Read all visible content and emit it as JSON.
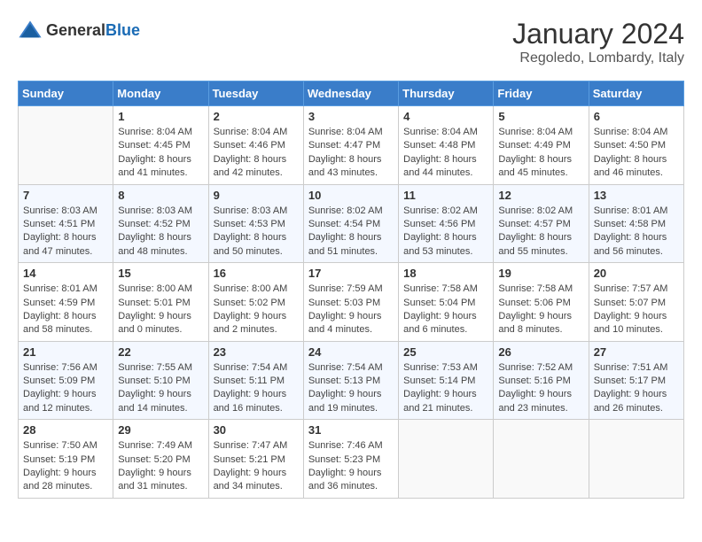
{
  "header": {
    "logo_general": "General",
    "logo_blue": "Blue",
    "month_title": "January 2024",
    "location": "Regoledo, Lombardy, Italy"
  },
  "weekdays": [
    "Sunday",
    "Monday",
    "Tuesday",
    "Wednesday",
    "Thursday",
    "Friday",
    "Saturday"
  ],
  "weeks": [
    [
      {
        "day": "",
        "sunrise": "",
        "sunset": "",
        "daylight": ""
      },
      {
        "day": "1",
        "sunrise": "Sunrise: 8:04 AM",
        "sunset": "Sunset: 4:45 PM",
        "daylight": "Daylight: 8 hours and 41 minutes."
      },
      {
        "day": "2",
        "sunrise": "Sunrise: 8:04 AM",
        "sunset": "Sunset: 4:46 PM",
        "daylight": "Daylight: 8 hours and 42 minutes."
      },
      {
        "day": "3",
        "sunrise": "Sunrise: 8:04 AM",
        "sunset": "Sunset: 4:47 PM",
        "daylight": "Daylight: 8 hours and 43 minutes."
      },
      {
        "day": "4",
        "sunrise": "Sunrise: 8:04 AM",
        "sunset": "Sunset: 4:48 PM",
        "daylight": "Daylight: 8 hours and 44 minutes."
      },
      {
        "day": "5",
        "sunrise": "Sunrise: 8:04 AM",
        "sunset": "Sunset: 4:49 PM",
        "daylight": "Daylight: 8 hours and 45 minutes."
      },
      {
        "day": "6",
        "sunrise": "Sunrise: 8:04 AM",
        "sunset": "Sunset: 4:50 PM",
        "daylight": "Daylight: 8 hours and 46 minutes."
      }
    ],
    [
      {
        "day": "7",
        "sunrise": "Sunrise: 8:03 AM",
        "sunset": "Sunset: 4:51 PM",
        "daylight": "Daylight: 8 hours and 47 minutes."
      },
      {
        "day": "8",
        "sunrise": "Sunrise: 8:03 AM",
        "sunset": "Sunset: 4:52 PM",
        "daylight": "Daylight: 8 hours and 48 minutes."
      },
      {
        "day": "9",
        "sunrise": "Sunrise: 8:03 AM",
        "sunset": "Sunset: 4:53 PM",
        "daylight": "Daylight: 8 hours and 50 minutes."
      },
      {
        "day": "10",
        "sunrise": "Sunrise: 8:02 AM",
        "sunset": "Sunset: 4:54 PM",
        "daylight": "Daylight: 8 hours and 51 minutes."
      },
      {
        "day": "11",
        "sunrise": "Sunrise: 8:02 AM",
        "sunset": "Sunset: 4:56 PM",
        "daylight": "Daylight: 8 hours and 53 minutes."
      },
      {
        "day": "12",
        "sunrise": "Sunrise: 8:02 AM",
        "sunset": "Sunset: 4:57 PM",
        "daylight": "Daylight: 8 hours and 55 minutes."
      },
      {
        "day": "13",
        "sunrise": "Sunrise: 8:01 AM",
        "sunset": "Sunset: 4:58 PM",
        "daylight": "Daylight: 8 hours and 56 minutes."
      }
    ],
    [
      {
        "day": "14",
        "sunrise": "Sunrise: 8:01 AM",
        "sunset": "Sunset: 4:59 PM",
        "daylight": "Daylight: 8 hours and 58 minutes."
      },
      {
        "day": "15",
        "sunrise": "Sunrise: 8:00 AM",
        "sunset": "Sunset: 5:01 PM",
        "daylight": "Daylight: 9 hours and 0 minutes."
      },
      {
        "day": "16",
        "sunrise": "Sunrise: 8:00 AM",
        "sunset": "Sunset: 5:02 PM",
        "daylight": "Daylight: 9 hours and 2 minutes."
      },
      {
        "day": "17",
        "sunrise": "Sunrise: 7:59 AM",
        "sunset": "Sunset: 5:03 PM",
        "daylight": "Daylight: 9 hours and 4 minutes."
      },
      {
        "day": "18",
        "sunrise": "Sunrise: 7:58 AM",
        "sunset": "Sunset: 5:04 PM",
        "daylight": "Daylight: 9 hours and 6 minutes."
      },
      {
        "day": "19",
        "sunrise": "Sunrise: 7:58 AM",
        "sunset": "Sunset: 5:06 PM",
        "daylight": "Daylight: 9 hours and 8 minutes."
      },
      {
        "day": "20",
        "sunrise": "Sunrise: 7:57 AM",
        "sunset": "Sunset: 5:07 PM",
        "daylight": "Daylight: 9 hours and 10 minutes."
      }
    ],
    [
      {
        "day": "21",
        "sunrise": "Sunrise: 7:56 AM",
        "sunset": "Sunset: 5:09 PM",
        "daylight": "Daylight: 9 hours and 12 minutes."
      },
      {
        "day": "22",
        "sunrise": "Sunrise: 7:55 AM",
        "sunset": "Sunset: 5:10 PM",
        "daylight": "Daylight: 9 hours and 14 minutes."
      },
      {
        "day": "23",
        "sunrise": "Sunrise: 7:54 AM",
        "sunset": "Sunset: 5:11 PM",
        "daylight": "Daylight: 9 hours and 16 minutes."
      },
      {
        "day": "24",
        "sunrise": "Sunrise: 7:54 AM",
        "sunset": "Sunset: 5:13 PM",
        "daylight": "Daylight: 9 hours and 19 minutes."
      },
      {
        "day": "25",
        "sunrise": "Sunrise: 7:53 AM",
        "sunset": "Sunset: 5:14 PM",
        "daylight": "Daylight: 9 hours and 21 minutes."
      },
      {
        "day": "26",
        "sunrise": "Sunrise: 7:52 AM",
        "sunset": "Sunset: 5:16 PM",
        "daylight": "Daylight: 9 hours and 23 minutes."
      },
      {
        "day": "27",
        "sunrise": "Sunrise: 7:51 AM",
        "sunset": "Sunset: 5:17 PM",
        "daylight": "Daylight: 9 hours and 26 minutes."
      }
    ],
    [
      {
        "day": "28",
        "sunrise": "Sunrise: 7:50 AM",
        "sunset": "Sunset: 5:19 PM",
        "daylight": "Daylight: 9 hours and 28 minutes."
      },
      {
        "day": "29",
        "sunrise": "Sunrise: 7:49 AM",
        "sunset": "Sunset: 5:20 PM",
        "daylight": "Daylight: 9 hours and 31 minutes."
      },
      {
        "day": "30",
        "sunrise": "Sunrise: 7:47 AM",
        "sunset": "Sunset: 5:21 PM",
        "daylight": "Daylight: 9 hours and 34 minutes."
      },
      {
        "day": "31",
        "sunrise": "Sunrise: 7:46 AM",
        "sunset": "Sunset: 5:23 PM",
        "daylight": "Daylight: 9 hours and 36 minutes."
      },
      {
        "day": "",
        "sunrise": "",
        "sunset": "",
        "daylight": ""
      },
      {
        "day": "",
        "sunrise": "",
        "sunset": "",
        "daylight": ""
      },
      {
        "day": "",
        "sunrise": "",
        "sunset": "",
        "daylight": ""
      }
    ]
  ]
}
